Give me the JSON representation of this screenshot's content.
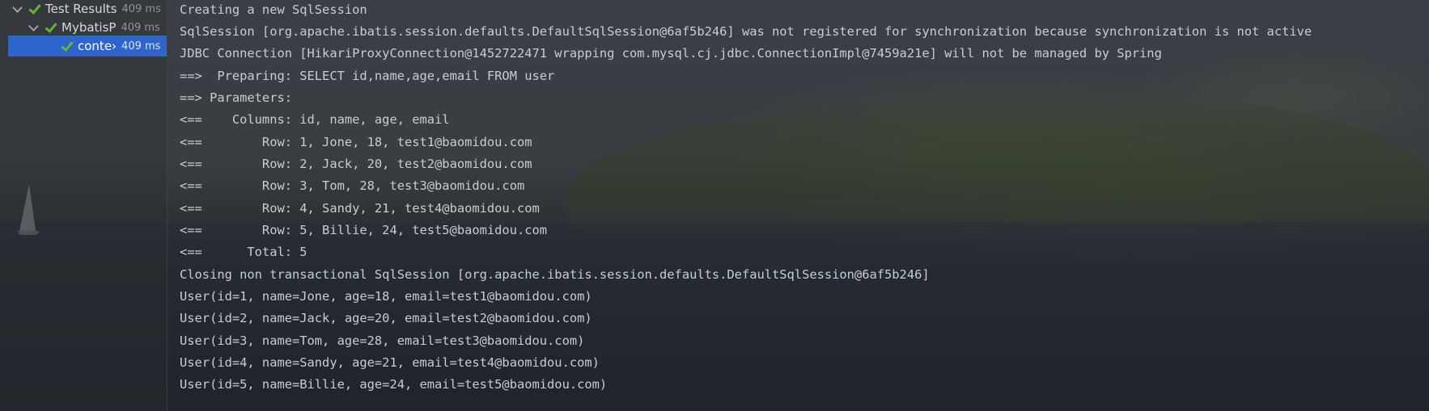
{
  "test_tree": {
    "items": [
      {
        "label": "Test Results",
        "time": "409 ms",
        "expanded": true,
        "status": "passed"
      },
      {
        "label": "MybatisP",
        "time": "409 ms",
        "expanded": true,
        "status": "passed"
      },
      {
        "label": "conte›",
        "time": "409 ms",
        "selected": true,
        "status": "passed"
      }
    ]
  },
  "console": {
    "lines": [
      "Creating a new SqlSession",
      "SqlSession [org.apache.ibatis.session.defaults.DefaultSqlSession@6af5b246] was not registered for synchronization because synchronization is not active",
      "JDBC Connection [HikariProxyConnection@1452722471 wrapping com.mysql.cj.jdbc.ConnectionImpl@7459a21e] will not be managed by Spring",
      "==>  Preparing: SELECT id,name,age,email FROM user",
      "==> Parameters: ",
      "<==    Columns: id, name, age, email",
      "<==        Row: 1, Jone, 18, test1@baomidou.com",
      "<==        Row: 2, Jack, 20, test2@baomidou.com",
      "<==        Row: 3, Tom, 28, test3@baomidou.com",
      "<==        Row: 4, Sandy, 21, test4@baomidou.com",
      "<==        Row: 5, Billie, 24, test5@baomidou.com",
      "<==      Total: 5",
      "Closing non transactional SqlSession [org.apache.ibatis.session.defaults.DefaultSqlSession@6af5b246]",
      "User(id=1, name=Jone, age=18, email=test1@baomidou.com)",
      "User(id=2, name=Jack, age=20, email=test2@baomidou.com)",
      "User(id=3, name=Tom, age=28, email=test3@baomidou.com)",
      "User(id=4, name=Sandy, age=21, email=test4@baomidou.com)",
      "User(id=5, name=Billie, age=24, email=test5@baomidou.com)"
    ]
  },
  "colors": {
    "pass_check": "#5fb832",
    "selection": "#2f65ca",
    "console_text": "#c9ccd0"
  }
}
